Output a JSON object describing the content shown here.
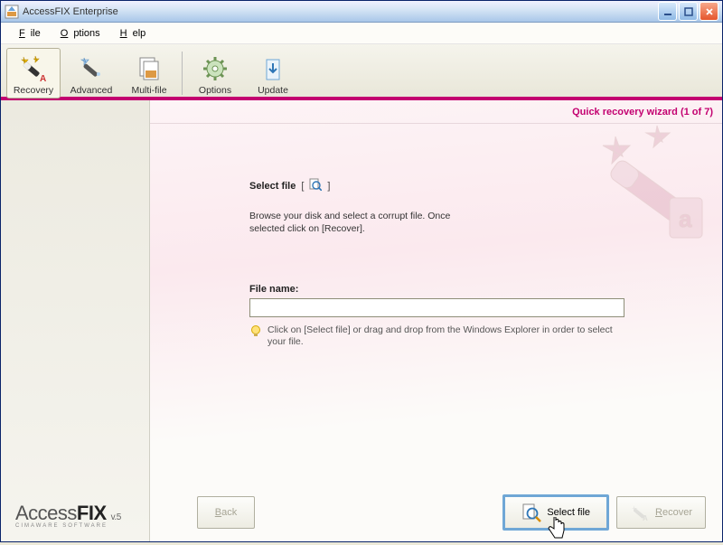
{
  "titlebar": {
    "title": "AccessFIX Enterprise"
  },
  "menu": {
    "file": "File",
    "file_und": "F",
    "options": "Options",
    "options_und": "O",
    "help": "Help",
    "help_und": "H"
  },
  "toolbar": {
    "recovery": "Recovery",
    "advanced": "Advanced",
    "multifile": "Multi-file",
    "options": "Options",
    "update": "Update"
  },
  "wizard": {
    "header": "Quick recovery wizard (1 of 7)"
  },
  "content": {
    "select_title": "Select file",
    "description": "Browse your disk and select a corrupt file. Once selected click on [Recover].",
    "file_label": "File name:",
    "file_value": "",
    "hint": "Click on [Select file] or drag and drop from the Windows Explorer in order to select your file."
  },
  "footer": {
    "back": "Back",
    "select_file": "Select file",
    "recover": "Recover"
  },
  "brand": {
    "name_a": "Access",
    "name_b": "FIX",
    "ver": "v.5",
    "sub": "CIMAWARE SOFTWARE"
  }
}
